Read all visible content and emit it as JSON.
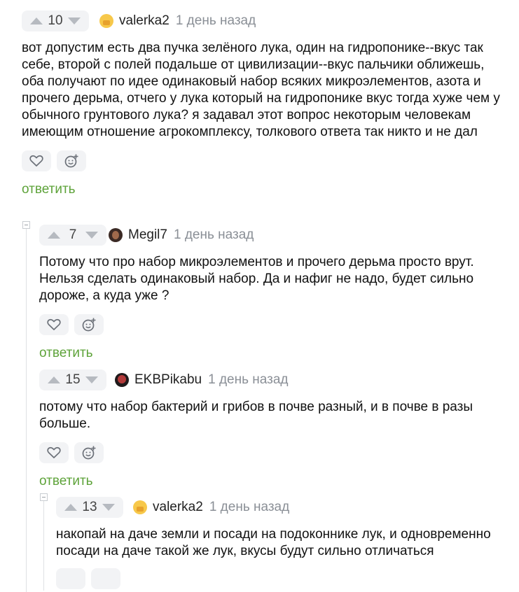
{
  "comments": [
    {
      "votes": "10",
      "username": "valerka2",
      "time": "1 день назад",
      "text": "вот допустим есть два пучка зелёного лука, один на гидропонике--вкус так себе, второй с полей подальше от цивилизации--вкус пальчики оближешь, оба получают по идее одинаковый набор всяких микроэлементов, азота и прочего дерьма, отчего у лука который на гидропонике вкус тогда хуже чем у обычного грунтового лука? я задавал этот вопрос некоторым человекам имеющим отношение агрокомплексу, толкового ответа так никто и не дал",
      "reply": "ответить"
    },
    {
      "votes": "7",
      "username": "Megil7",
      "time": "1 день назад",
      "text": "Потому что про набор микроэлементов и прочего дерьма просто врут. Нельзя сделать одинаковый набор. Да и нафиг не надо, будет сильно дороже, а куда уже ?",
      "reply": "ответить"
    },
    {
      "votes": "15",
      "username": "EKBPikabu",
      "time": "1 день назад",
      "text": "потому что набор бактерий и грибов в почве разный, и в почве в разы больше.",
      "reply": "ответить"
    },
    {
      "votes": "13",
      "username": "valerka2",
      "time": "1 день назад",
      "text": "накопай на даче земли и посади на подоконнике лук, и одновременно посади на даче такой же лук, вкусы будут сильно отличаться",
      "reply": ""
    }
  ],
  "icons": {
    "upvote": "arrow-up-icon",
    "downvote": "arrow-down-icon",
    "like": "heart-icon",
    "reaction": "smile-plus-icon",
    "collapse": "collapse-minus-icon"
  },
  "colors": {
    "reply_link": "#5ea33a",
    "muted_text": "#8a8f96",
    "button_bg": "#f2f3f5"
  }
}
